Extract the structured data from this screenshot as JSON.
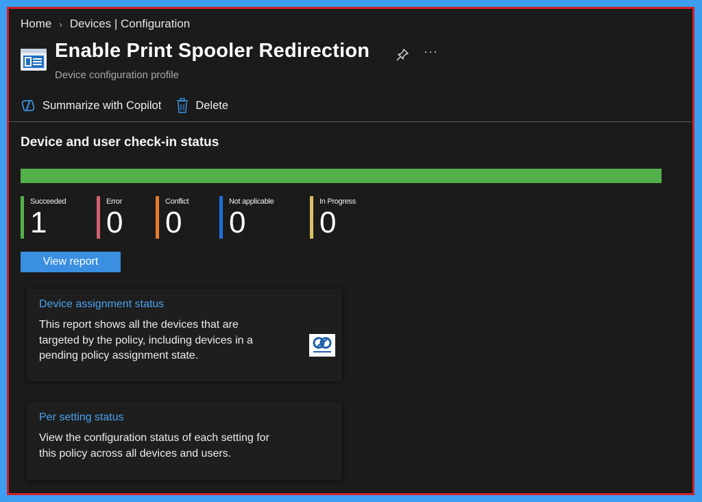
{
  "breadcrumb": {
    "home": "Home",
    "separator": "›",
    "section": "Devices | Configuration"
  },
  "header": {
    "title": "Enable Print Spooler Redirection",
    "subtitle": "Device configuration profile",
    "more_label": "···"
  },
  "toolbar": {
    "summarize_label": "Summarize with Copilot",
    "delete_label": "Delete"
  },
  "checkin": {
    "title": "Device and user check-in status",
    "progress_fraction": 1.0,
    "stats": [
      {
        "label": "Succeeded",
        "value": "1",
        "color": "#54b04a"
      },
      {
        "label": "Error",
        "value": "0",
        "color": "#d0616c"
      },
      {
        "label": "Conflict",
        "value": "0",
        "color": "#e87b2c"
      },
      {
        "label": "Not applicable",
        "value": "0",
        "color": "#1f6fe0"
      },
      {
        "label": "In Progress",
        "value": "0",
        "color": "#dcc064"
      }
    ],
    "view_report_label": "View report"
  },
  "cards": [
    {
      "title": "Device assignment status",
      "description": "This report shows all the devices that are targeted by the policy, including devices in a pending policy assignment state."
    },
    {
      "title": "Per setting status",
      "description": "View the configuration status of each setting for this policy across all devices and users."
    }
  ],
  "colors": {
    "frame_border": "#d0202a",
    "outer_background": "#3d9df0",
    "background": "#1b1b1b",
    "accent": "#3a8fe0",
    "link": "#4aa3f0"
  },
  "icons": {
    "profile": "device-configuration-icon",
    "pin": "pin-icon",
    "copilot": "copilot-icon",
    "delete": "trash-icon",
    "logo": "community-logo"
  }
}
